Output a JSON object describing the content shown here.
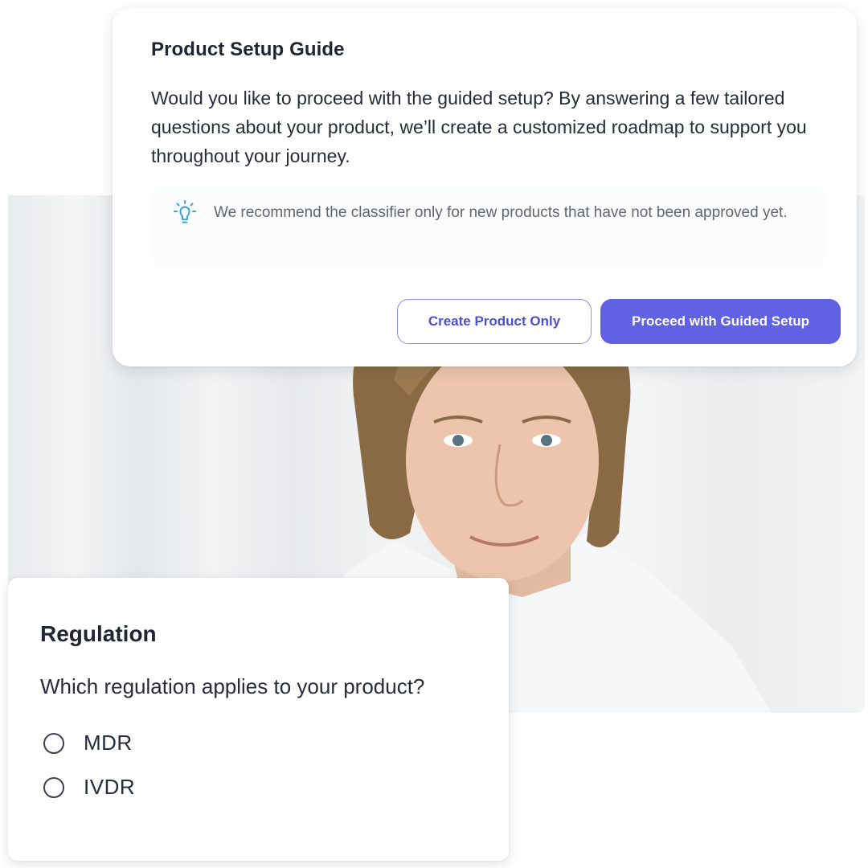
{
  "setup_guide": {
    "title": "Product Setup Guide",
    "body": "Would you like to proceed with the guided setup? By answering a few tailored questions about your product, we’ll create a customized roadmap to support you throughout your journey.",
    "tip_icon": "lightbulb-icon",
    "tip_text": "We recommend the classifier only for new products that have not been approved yet.",
    "secondary_button": "Create Product Only",
    "primary_button": "Proceed with Guided Setup"
  },
  "regulation": {
    "title": "Regulation",
    "question": "Which regulation applies to your product?",
    "options": [
      {
        "label": "MDR",
        "selected": false
      },
      {
        "label": "IVDR",
        "selected": false
      }
    ]
  },
  "colors": {
    "accent": "#6061e3",
    "accent_text": "#4e50c9",
    "tip_icon": "#3fa6c8"
  }
}
